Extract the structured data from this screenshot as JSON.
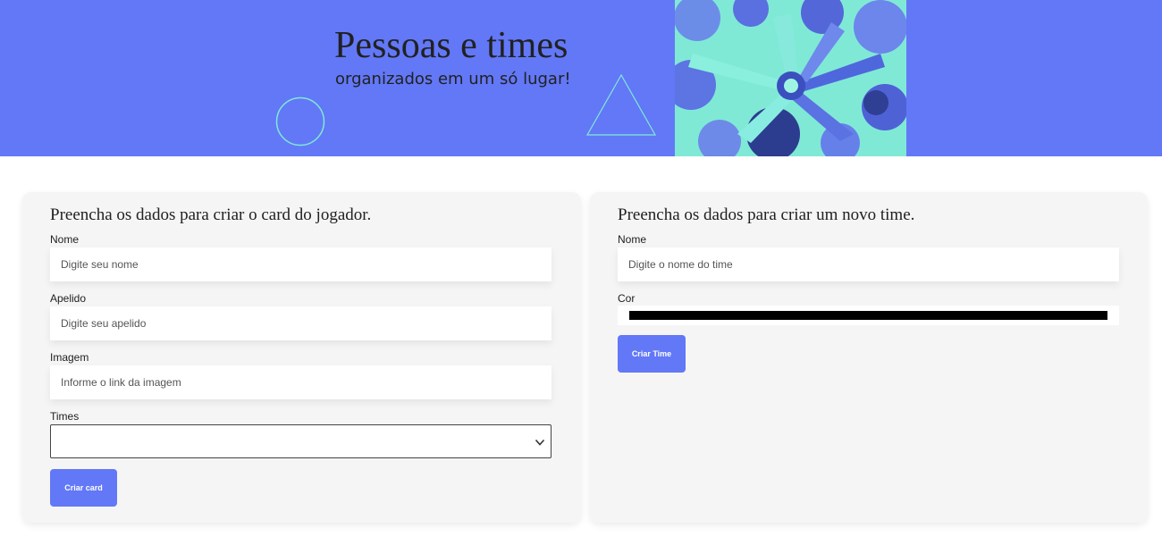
{
  "banner": {
    "title": "Pessoas e times",
    "subtitle": "organizados em um só lugar!",
    "background_color": "#6278f7",
    "image": "team-hands-together-photo"
  },
  "player_form": {
    "heading": "Preencha os dados para criar o card do jogador.",
    "name_label": "Nome",
    "name_placeholder": "Digite seu nome",
    "name_value": "",
    "nickname_label": "Apelido",
    "nickname_placeholder": "Digite seu apelido",
    "nickname_value": "",
    "image_label": "Imagem",
    "image_placeholder": "Informe o link da imagem",
    "image_value": "",
    "teams_label": "Times",
    "teams_selected": "",
    "submit_label": "Criar card"
  },
  "team_form": {
    "heading": "Preencha os dados para criar um novo time.",
    "name_label": "Nome",
    "name_placeholder": "Digite o nome do time",
    "name_value": "",
    "color_label": "Cor",
    "color_value": "#000000",
    "submit_label": "Criar Time"
  },
  "colors": {
    "accent": "#6278f7",
    "decoration": "#7fe9d6",
    "card_background": "#f5f5f5"
  }
}
